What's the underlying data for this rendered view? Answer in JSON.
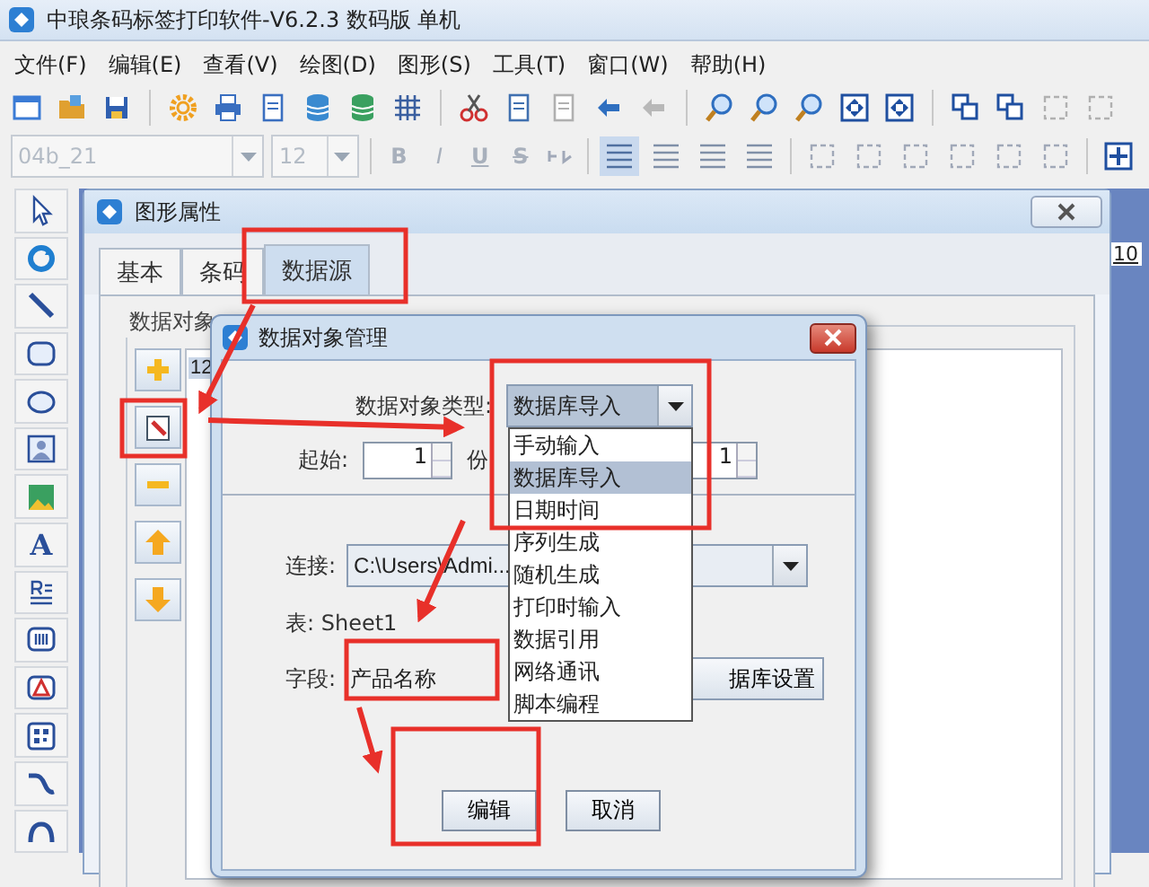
{
  "app": {
    "title": "中琅条码标签打印软件-V6.2.3 数码版 单机"
  },
  "menu": [
    {
      "label": "文件(F)"
    },
    {
      "label": "编辑(E)"
    },
    {
      "label": "查看(V)"
    },
    {
      "label": "绘图(D)"
    },
    {
      "label": "图形(S)"
    },
    {
      "label": "工具(T)"
    },
    {
      "label": "窗口(W)"
    },
    {
      "label": "帮助(H)"
    }
  ],
  "format_bar": {
    "font": "04b_21",
    "size": "12",
    "style_buttons": [
      "B",
      "I",
      "U",
      "S"
    ]
  },
  "toolbox": {
    "text_tool": "A"
  },
  "ruler": {
    "label": "10"
  },
  "properties_window": {
    "title": "图形属性",
    "tabs": [
      {
        "label": "基本",
        "selected": false
      },
      {
        "label": "条码",
        "selected": false
      },
      {
        "label": "数据源",
        "selected": true
      }
    ],
    "group_label": "数据对象",
    "list_item": "12"
  },
  "dialog": {
    "title": "数据对象管理",
    "type_label": "数据对象类型:",
    "type_value": "数据库导入",
    "start_label": "起始:",
    "start_value": "1",
    "count_label": "份",
    "count_value": "1",
    "connection_label": "连接:",
    "connection_value": "C:\\Users\\Admi...",
    "table_label": "表: Sheet1",
    "field_label": "字段:",
    "field_value": "产品名称",
    "db_button": "据库设置",
    "buttons": [
      "编辑",
      "取消"
    ],
    "dropdown": [
      {
        "label": "手动输入",
        "selected": false
      },
      {
        "label": "数据库导入",
        "selected": true
      },
      {
        "label": "日期时间",
        "selected": false
      },
      {
        "label": "序列生成",
        "selected": false
      },
      {
        "label": "随机生成",
        "selected": false
      },
      {
        "label": "打印时输入",
        "selected": false
      },
      {
        "label": "数据引用",
        "selected": false
      },
      {
        "label": "网络通讯",
        "selected": false
      },
      {
        "label": "脚本编程",
        "selected": false
      }
    ]
  }
}
